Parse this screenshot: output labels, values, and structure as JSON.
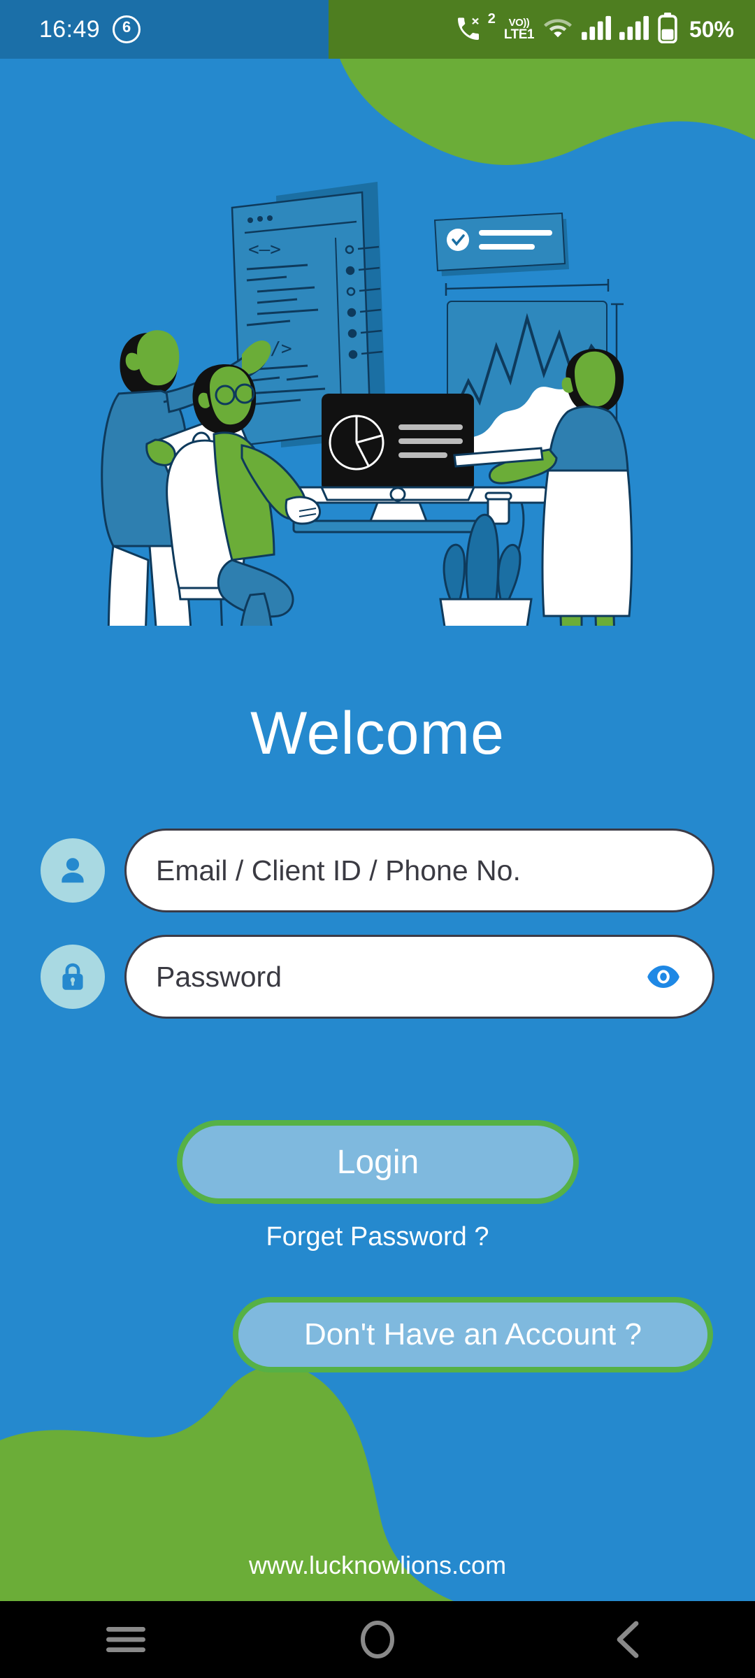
{
  "status_bar": {
    "time": "16:49",
    "notification_count": "6",
    "missed_call_count": "2",
    "volte_top": "VO))",
    "volte_bottom": "LTE1",
    "battery_percent": "50%",
    "icons": [
      "missed-call-icon",
      "volte-icon",
      "wifi-icon",
      "signal-sim1-icon",
      "signal-sim2-icon",
      "battery-icon"
    ]
  },
  "theme": {
    "background_blue": "#2589CE",
    "blob_green": "#6BAD38",
    "status_green": "#4E7E20",
    "button_fill": "#7FB9DE",
    "button_border": "#56B146",
    "icon_circle": "#A9D9E2",
    "icon_blue": "#2589CE",
    "eye_blue": "#1E88E5",
    "input_border": "#3B3B47",
    "text_white": "#FFFFFF"
  },
  "illustration": {
    "name": "team-data-dashboard-illustration",
    "description": "Flat illustration of a team working with dashboards, code editor, charts and a computer"
  },
  "main": {
    "heading": "Welcome",
    "username_field": {
      "placeholder": "Email / Client ID / Phone No.",
      "value": "",
      "icon": "user-icon"
    },
    "password_field": {
      "placeholder": "Password",
      "value": "",
      "icon": "lock-icon",
      "toggle_icon": "eye-icon"
    },
    "login_label": "Login",
    "forget_password_label": "Forget Password ?",
    "signup_label": "Don't Have an Account ?"
  },
  "footer": {
    "website": "www.lucknowlions.com"
  },
  "nav_bar": {
    "recents": "recents-icon",
    "home": "home-icon",
    "back": "back-icon"
  }
}
